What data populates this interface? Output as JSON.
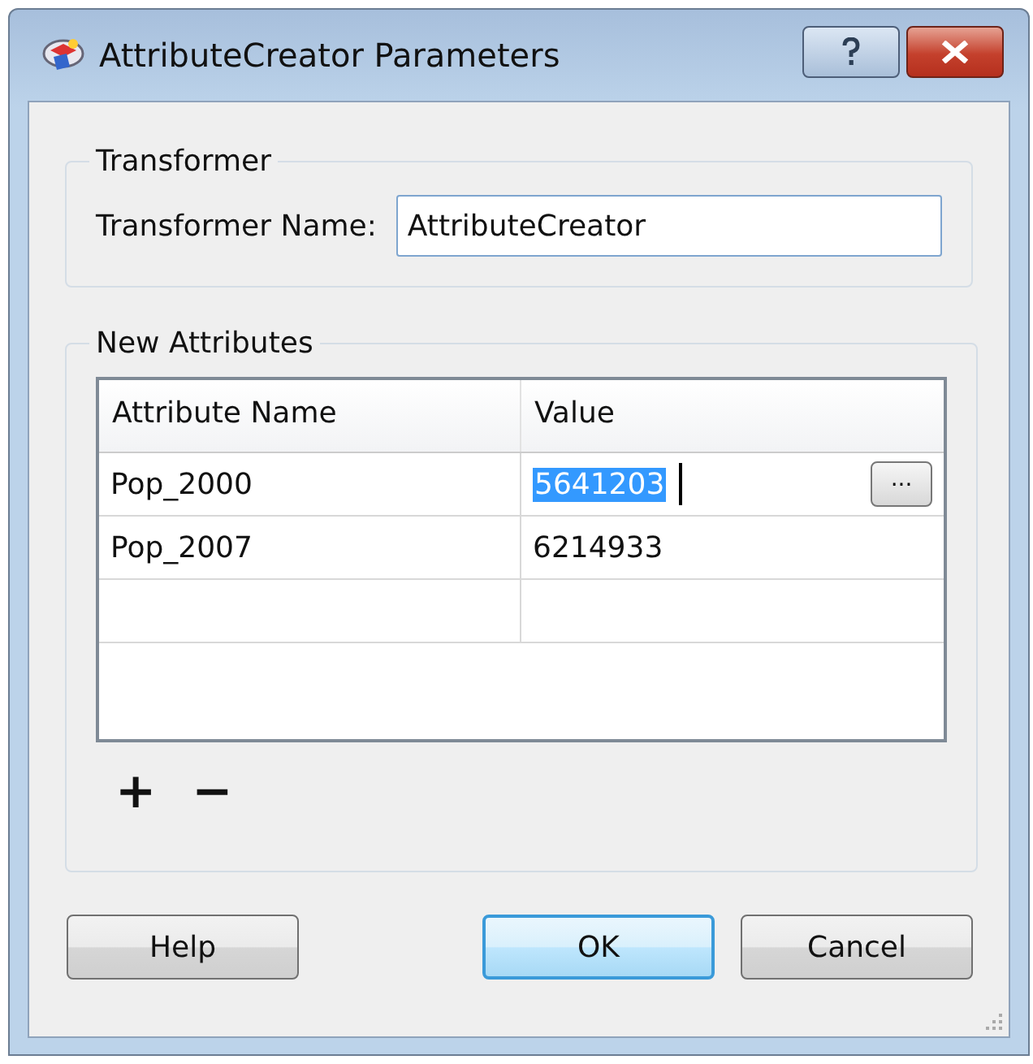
{
  "window": {
    "title": "AttributeCreator Parameters"
  },
  "transformer": {
    "group_title": "Transformer",
    "name_label": "Transformer Name:",
    "name_value": "AttributeCreator"
  },
  "new_attributes": {
    "group_title": "New Attributes",
    "columns": [
      "Attribute Name",
      "Value"
    ],
    "rows": [
      {
        "name": "Pop_2000",
        "value": "5641203",
        "editing": true,
        "browse_label": "..."
      },
      {
        "name": "Pop_2007",
        "value": "6214933",
        "editing": false
      },
      {
        "editing": false
      }
    ],
    "add_label": "+",
    "remove_label": "−"
  },
  "buttons": [
    {
      "label": "Help",
      "default": false
    },
    {
      "label": "OK",
      "default": true
    },
    {
      "label": "Cancel",
      "default": false
    }
  ]
}
